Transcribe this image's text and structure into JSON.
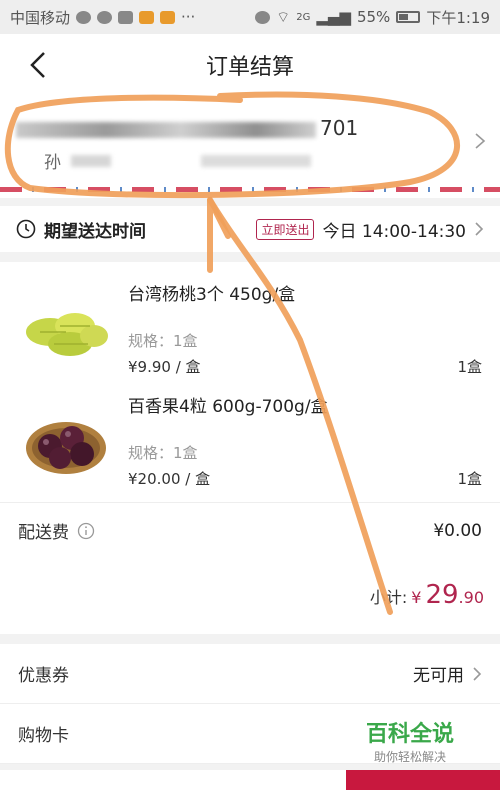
{
  "status_bar": {
    "carrier": "中国移动",
    "network": "2G",
    "battery": "55%",
    "time": "下午1:19"
  },
  "header": {
    "title": "订单结算"
  },
  "address": {
    "line1_suffix": "701",
    "line2_prefix": "孙"
  },
  "delivery": {
    "label": "期望送达时间",
    "badge": "立即送出",
    "time": "今日 14:00-14:30"
  },
  "products": [
    {
      "name": "台湾杨桃3个 450g/盒",
      "spec": "规格：1盒",
      "price": "¥9.90 / 盒",
      "qty": "1盒"
    },
    {
      "name": "百香果4粒 600g-700g/盒",
      "spec": "规格：1盒",
      "price": "¥20.00 / 盒",
      "qty": "1盒"
    }
  ],
  "fee": {
    "label": "配送费",
    "value": "¥0.00"
  },
  "subtotal": {
    "label": "小计:",
    "currency": "¥",
    "integer": "29",
    "decimal": ".90"
  },
  "coupon": {
    "label": "优惠券",
    "value": "无可用"
  },
  "gift_card": {
    "label": "购物卡"
  },
  "watermark": {
    "title": "百科全说",
    "subtitle": "助你轻松解决"
  },
  "colors": {
    "accent": "#b0254e",
    "submit": "#c8183e",
    "annotation": "#f0a05a"
  }
}
